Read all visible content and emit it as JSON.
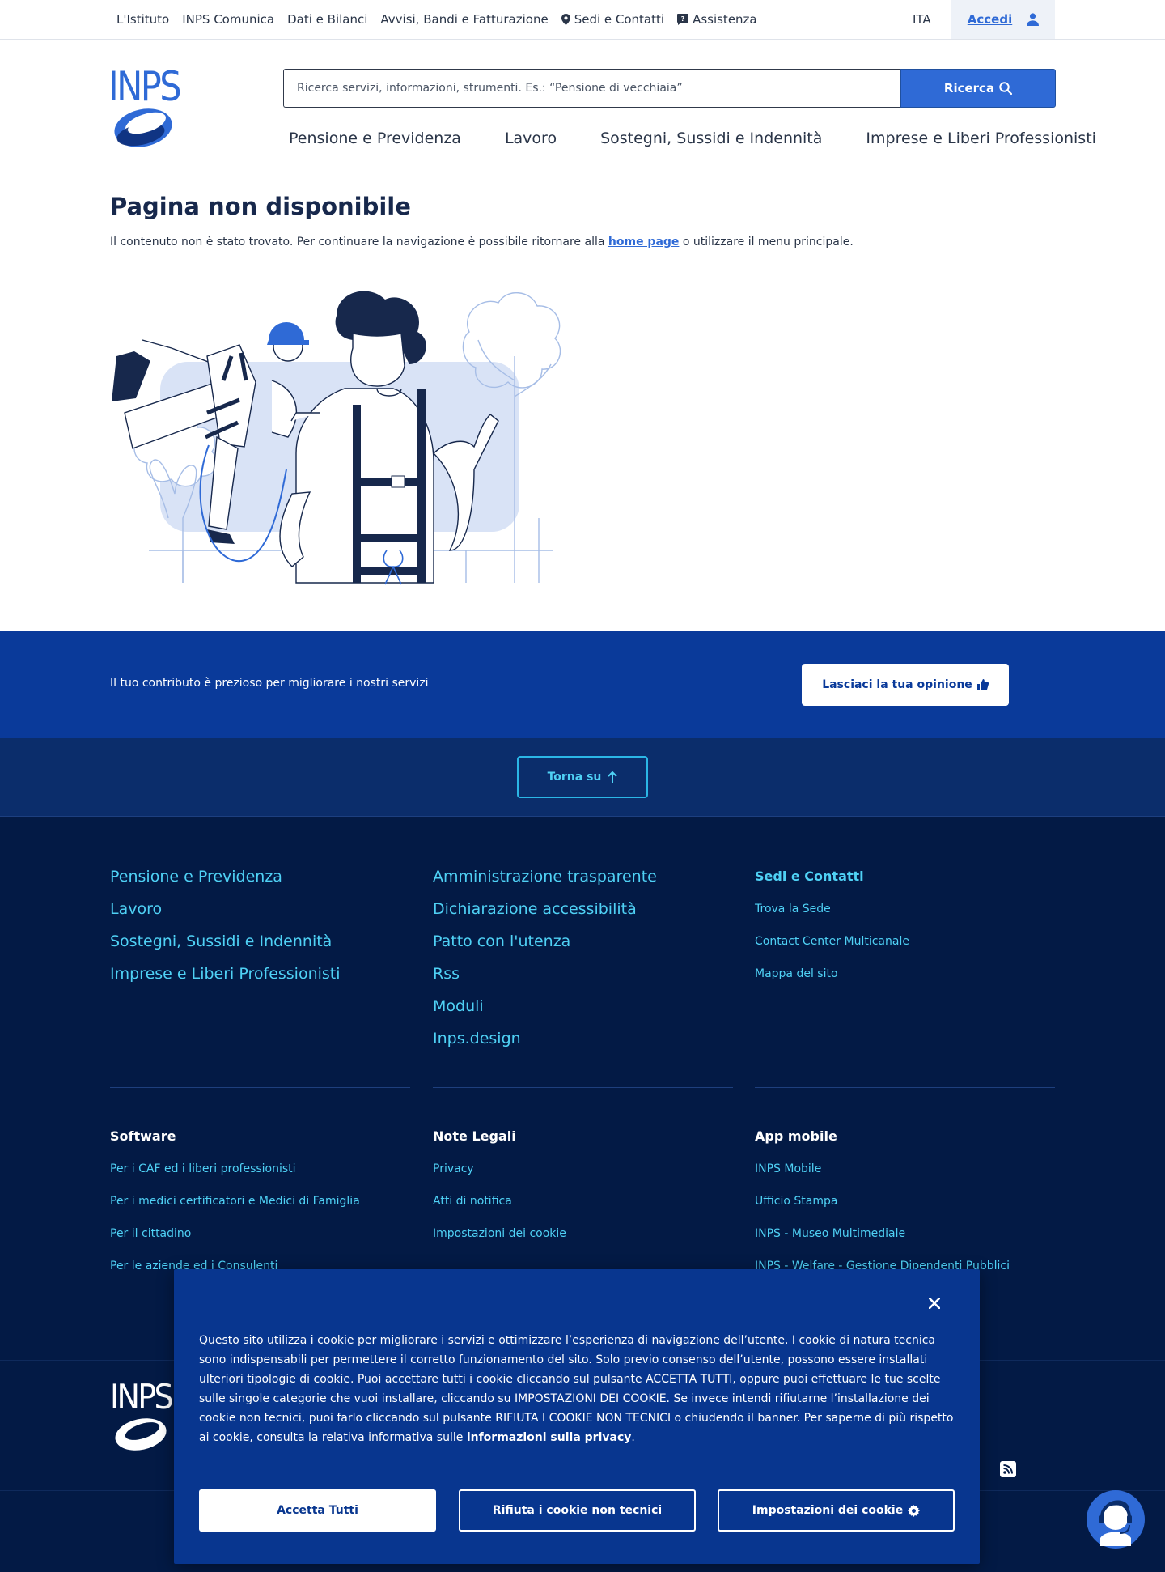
{
  "topbar": {
    "links": [
      {
        "label": "L'Istituto"
      },
      {
        "label": "INPS Comunica"
      },
      {
        "label": "Dati e Bilanci"
      },
      {
        "label": "Avvisi, Bandi e Fatturazione"
      },
      {
        "label": "Sedi e Contatti",
        "icon": "map-pin-icon"
      },
      {
        "label": "Assistenza",
        "icon": "help-chat-icon"
      }
    ],
    "language": "ITA",
    "login_label": "Accedi",
    "login_icon": "user-icon"
  },
  "header": {
    "logo_text": "INPS",
    "search": {
      "placeholder": "Ricerca servizi, informazioni, strumenti. Es.: “Pensione di vecchiaia”",
      "value": "",
      "button_label": "Ricerca"
    },
    "nav": [
      {
        "label": "Pensione e Previdenza"
      },
      {
        "label": "Lavoro"
      },
      {
        "label": "Sostegni, Sussidi e Indennità"
      },
      {
        "label": "Imprese e Liberi Professionisti"
      }
    ]
  },
  "content": {
    "title": "Pagina non disponibile",
    "desc_before": "Il contenuto non è stato trovato. Per continuare la navigazione è possibile ritornare alla ",
    "desc_link": "home page",
    "desc_after": " o utilizzare il menu principale."
  },
  "feedback": {
    "text": "Il tuo contributo è prezioso per migliorare i nostri servizi",
    "button_label": "Lasciaci la tua opinione"
  },
  "back_to_top": {
    "label": "Torna su"
  },
  "footer": {
    "col1": [
      "Pensione e Previdenza",
      "Lavoro",
      "Sostegni, Sussidi e Indennità",
      "Imprese e Liberi Professionisti"
    ],
    "col2": [
      "Amministrazione trasparente",
      "Dichiarazione accessibilità",
      "Patto con l'utenza",
      "Rss",
      "Moduli",
      "Inps.design"
    ],
    "col3_title": "Sedi e Contatti",
    "col3": [
      "Trova la Sede",
      "Contact Center Multicanale",
      "Mappa del sito"
    ],
    "software_title": "Software",
    "software": [
      "Per i CAF ed i liberi professionisti",
      "Per i medici certificatori e Medici di Famiglia",
      "Per il cittadino",
      "Per le aziende ed i Consulenti"
    ],
    "legal_title": "Note Legali",
    "legal": [
      "Privacy",
      "Atti di notifica",
      "Impostazioni dei cookie"
    ],
    "app_title": "App mobile",
    "app": [
      "INPS Mobile",
      "Ufficio Stampa",
      "INPS - Museo Multimediale",
      "INPS - Welfare - Gestione Dipendenti Pubblici"
    ],
    "logo_text": "INPS"
  },
  "cookie": {
    "text_before": "Questo sito utilizza i cookie per migliorare i servizi e ottimizzare l’esperienza di navigazione dell’utente. I cookie di natura tecnica sono indispensabili per permettere il corretto funzionamento del sito. Solo previo consenso dell’utente, possono essere installati ulteriori tipologie di cookie. Puoi accettare tutti i cookie cliccando sul pulsante ACCETTA TUTTI, oppure puoi effettuare le tue scelte sulle singole categorie che vuoi installare, cliccando su IMPOSTAZIONI DEI COOKIE. Se invece intendi rifiutarne l’installazione dei cookie non tecnici, puoi farlo cliccando sul pulsante RIFIUTA I COOKIE NON TECNICI o chiudendo il banner. Per saperne di più rispetto ai cookie, consulta la relativa informativa sulle ",
    "text_link": "informazioni sulla privacy",
    "text_after": ".",
    "accept_label": "Accetta Tutti",
    "reject_label": "Rifiuta i cookie non tecnici",
    "settings_label": "Impostazioni dei cookie"
  },
  "colors": {
    "primary": "#2f6ad6",
    "navy": "#17284c",
    "feedback_band": "#0a3a9a",
    "footer_bg": "#031a45",
    "footer_link": "#4fd1f5"
  }
}
